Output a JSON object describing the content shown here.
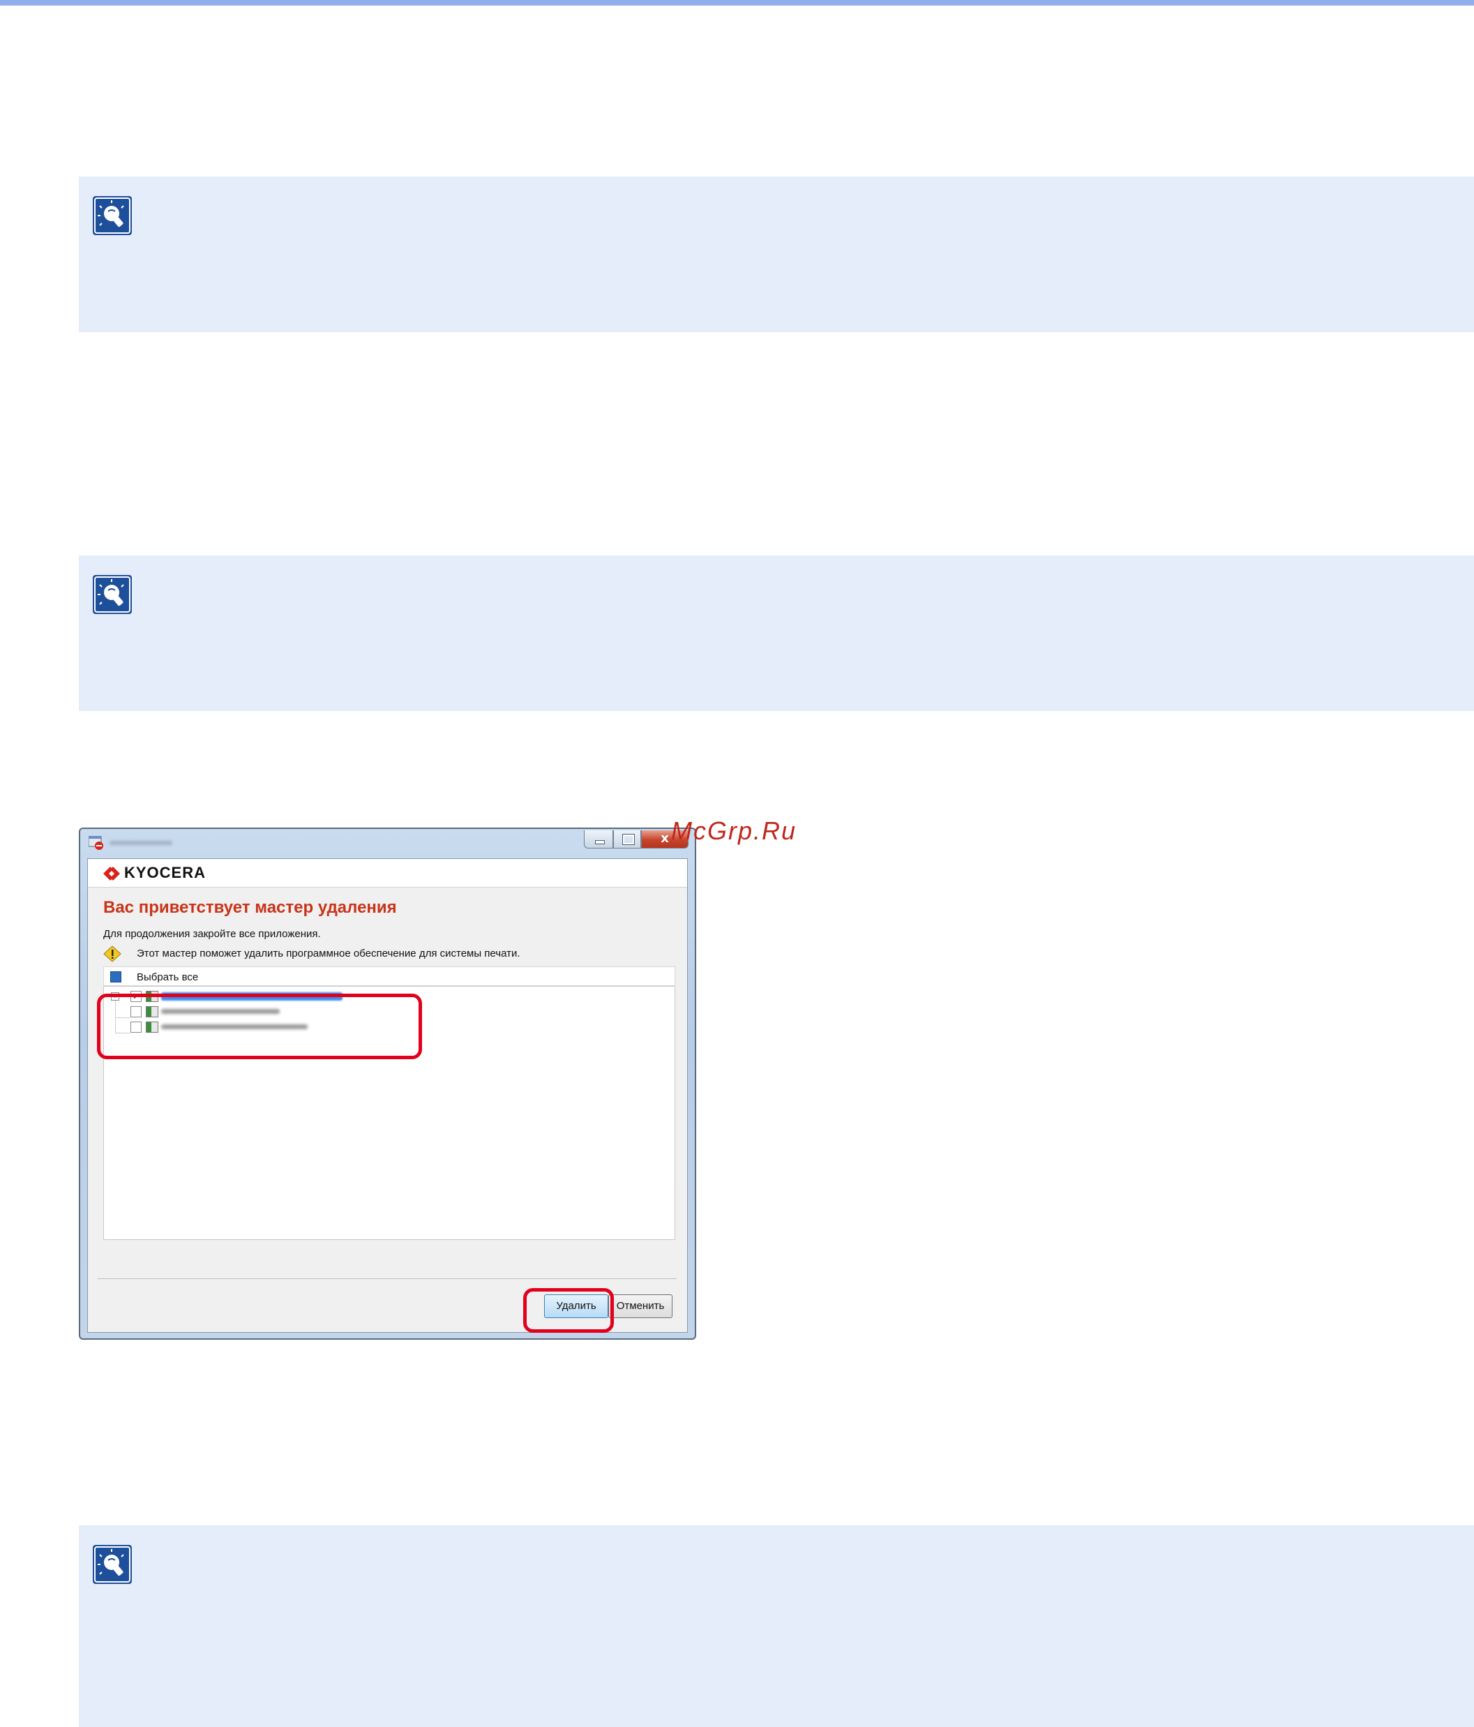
{
  "colors": {
    "note_background": "#e5ecfa",
    "accent_blue": "#8fb0ea",
    "highlight_red": "#e3001b",
    "wizard_title_red": "#c8341a"
  },
  "note_icon": "lightbulb-icon",
  "watermark": "McGrp.Ru",
  "screenshot": {
    "logo_text": "KYOCERA",
    "title": "Вас приветствует мастер удаления",
    "subtitle": "Для продолжения закройте все приложения.",
    "info": "Этот мастер поможет удалить программное обеспечение для системы печати.",
    "select_all_label": "Выбрать все",
    "tree_items": [
      {
        "checked": true,
        "expandable": true
      },
      {
        "checked": false,
        "expandable": false
      },
      {
        "checked": false,
        "expandable": false
      }
    ],
    "buttons": {
      "delete_label": "Удалить",
      "cancel_label": "Отменить",
      "close_glyph": "x"
    }
  }
}
